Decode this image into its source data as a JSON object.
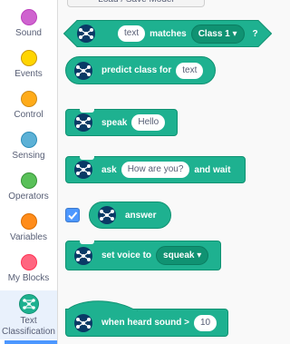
{
  "sidebar": {
    "categories": [
      {
        "label": "Sound",
        "color": "#cf63cf"
      },
      {
        "label": "Events",
        "color": "#ffd500"
      },
      {
        "label": "Control",
        "color": "#ffab19"
      },
      {
        "label": "Sensing",
        "color": "#5cb1d6"
      },
      {
        "label": "Operators",
        "color": "#59c059"
      },
      {
        "label": "Variables",
        "color": "#ff8c1a"
      },
      {
        "label": "My Blocks",
        "color": "#ff6680"
      }
    ],
    "selected": {
      "label": "Text Classification",
      "icon": "ml-network-icon",
      "color": "#1eb190"
    }
  },
  "palette": {
    "load_save_label": "Load / Save Model",
    "block_color": "#1eb190",
    "matches_block": {
      "input": "text",
      "label": "matches",
      "dropdown": "Class 1 ▾",
      "question": "?"
    },
    "predict_block": {
      "label": "predict class for",
      "input": "text"
    },
    "speak_block": {
      "label": "speak",
      "input": "Hello"
    },
    "ask_block": {
      "label": "ask",
      "input": "How are you?",
      "suffix": "and wait"
    },
    "answer_block": {
      "label": "answer",
      "checked": true
    },
    "voice_block": {
      "label": "set voice to",
      "dropdown": "squeak ▾"
    },
    "sound_block": {
      "label": "when heard sound >",
      "input": "10"
    }
  }
}
